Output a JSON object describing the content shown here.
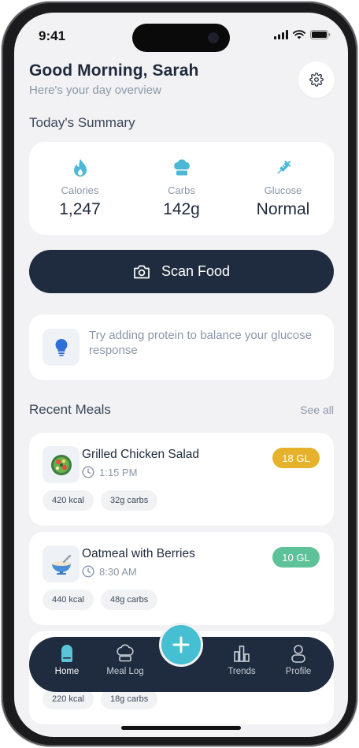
{
  "status_bar": {
    "time": "9:41"
  },
  "header": {
    "greeting": "Good Morning, Sarah",
    "subtitle": "Here's your day overview"
  },
  "summary": {
    "title": "Today's Summary",
    "stats": [
      {
        "label": "Calories",
        "value": "1,247",
        "icon": "flame-icon"
      },
      {
        "label": "Carbs",
        "value": "142g",
        "icon": "chef-hat-icon"
      },
      {
        "label": "Glucose",
        "value": "Normal",
        "icon": "syringe-icon"
      }
    ]
  },
  "scan_button": {
    "label": "Scan Food",
    "icon": "camera-icon"
  },
  "tip": {
    "text": "Try adding protein to balance your glucose response",
    "icon": "lightbulb-icon"
  },
  "recent_meals": {
    "title": "Recent Meals",
    "see_all": "See all",
    "items": [
      {
        "name": "Grilled Chicken Salad",
        "time": "1:15 PM",
        "gl": "18 GL",
        "gl_color": "#e7b22b",
        "calories": "420 kcal",
        "carbs": "32g carbs",
        "icon": "salad-bowl-icon"
      },
      {
        "name": "Oatmeal with Berries",
        "time": "8:30 AM",
        "gl": "10 GL",
        "gl_color": "#5ec298",
        "calories": "440 kcal",
        "carbs": "48g carbs",
        "icon": "oatmeal-bowl-icon"
      },
      {
        "calories": "220 kcal",
        "carbs": "18g carbs"
      }
    ]
  },
  "tab_bar": {
    "items": [
      {
        "label": "Home",
        "icon": "home-icon",
        "active": true
      },
      {
        "label": "Meal Log",
        "icon": "chef-hat-icon"
      },
      {
        "label": "Trends",
        "icon": "bar-chart-icon"
      },
      {
        "label": "Profile",
        "icon": "user-icon"
      }
    ],
    "fab_icon": "plus-icon"
  },
  "colors": {
    "accent": "#45bfd1",
    "navy": "#1f2b3e",
    "background": "#f2f2f4"
  }
}
